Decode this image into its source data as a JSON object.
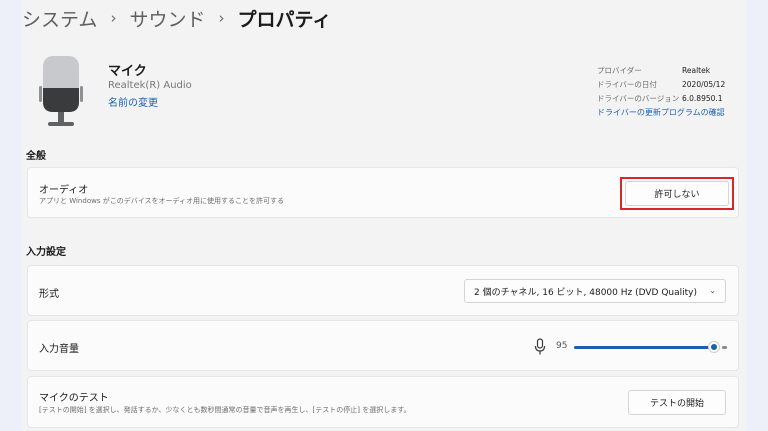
{
  "breadcrumb": {
    "items": [
      "システム",
      "サウンド",
      "プロパティ"
    ],
    "separator": "›"
  },
  "device": {
    "name": "マイク",
    "subtitle": "Realtek(R) Audio",
    "rename_link": "名前の変更",
    "icon": "microphone-icon"
  },
  "driver": {
    "rows": [
      {
        "key": "プロバイダー",
        "value": "Realtek"
      },
      {
        "key": "ドライバーの日付",
        "value": "2020/05/12"
      },
      {
        "key": "ドライバーのバージョン",
        "value": "6.0.8950.1"
      }
    ],
    "update_link": "ドライバーの更新プログラムの確認"
  },
  "general": {
    "section_title": "全般",
    "audio": {
      "title": "オーディオ",
      "description": "アプリと Windows がこのデバイスをオーディオ用に使用することを許可する",
      "button": "許可しない"
    }
  },
  "input": {
    "section_title": "入力設定",
    "format": {
      "title": "形式",
      "selected": "2 個のチャネル, 16 ビット, 48000 Hz (DVD Quality)",
      "chevron_icon": "chevron-down-icon"
    },
    "volume": {
      "title": "入力音量",
      "value": "95",
      "fraction": 0.95,
      "icon": "microphone-icon"
    },
    "test": {
      "title": "マイクのテスト",
      "description": "[テストの開始] を選択し、発話するか、少なくとも数秒間通常の音量で音声を再生し、[テストの停止] を選択します。",
      "button": "テストの開始"
    }
  },
  "colors": {
    "accent": "#1a5fb4",
    "highlight": "#d9262b",
    "background": "#f3f3f3",
    "card": "#fbfbfb"
  }
}
